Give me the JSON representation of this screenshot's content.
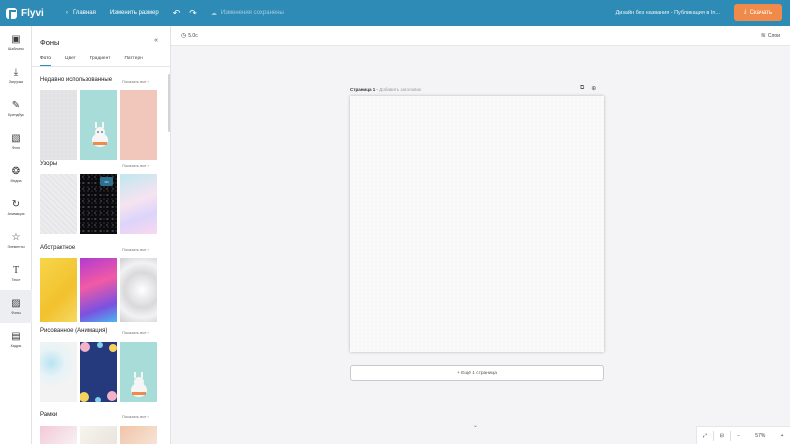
{
  "topbar": {
    "logo": "Flyvi",
    "back_label": "Главная",
    "resize_label": "Изменить размер",
    "undo_icon": "undo-icon",
    "redo_icon": "redo-icon",
    "save_status": "Изменения сохранены",
    "project_title": "Дизайн без названия - Публикация в In...",
    "download_label": "Скачать"
  },
  "rail": {
    "items": [
      {
        "label": "Шаблоны",
        "icon": "▣"
      },
      {
        "label": "Загрузки",
        "icon": "⤓"
      },
      {
        "label": "Брендбук",
        "icon": "✎"
      },
      {
        "label": "Фото",
        "icon": "▧"
      },
      {
        "label": "Медиа",
        "icon": "❂"
      },
      {
        "label": "Анимация",
        "icon": "↻"
      },
      {
        "label": "Элементы",
        "icon": "☆"
      },
      {
        "label": "Текст",
        "icon": "T"
      },
      {
        "label": "Фоны",
        "icon": "▨"
      },
      {
        "label": "Кадры",
        "icon": "▤"
      }
    ],
    "active_index": 8
  },
  "panel": {
    "title": "Фоны",
    "tabs": [
      "Фото",
      "Цвет",
      "Градиент",
      "Паттерн"
    ],
    "active_tab": 0,
    "sections": [
      {
        "title": "Недавно использованные",
        "more": "Показать все ›"
      },
      {
        "title": "Узоры",
        "more": "Показать все ›"
      },
      {
        "title": "Абстрактное",
        "more": "Показать все ›"
      },
      {
        "title": "Рисованное (Анимация)",
        "more": "Показать все ›"
      },
      {
        "title": "Рамки",
        "more": "Показать все ›"
      }
    ],
    "thumb_menu": "•••"
  },
  "canvas_toolbar": {
    "timer_label": "5.0с",
    "layers_label": "Слои"
  },
  "page": {
    "label": "Страница 1",
    "sub_label": "Добавить заголовок",
    "add_page_label": "+ Ещё 1 страница"
  },
  "zoom": {
    "value": "57%"
  },
  "colors": {
    "topbar": "#2d8bb5",
    "download": "#f08a4b",
    "accent": "#2d8bb5"
  }
}
